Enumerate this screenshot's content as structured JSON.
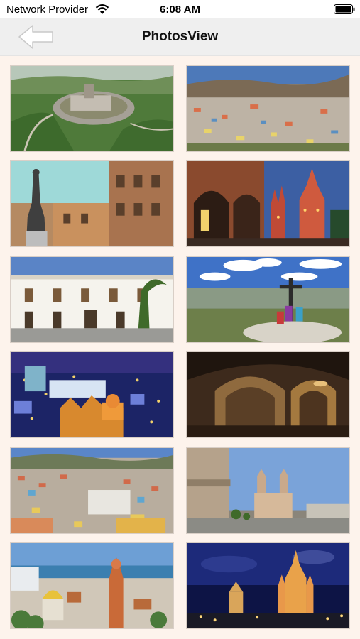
{
  "status_bar": {
    "carrier": "Network Provider",
    "time": "6:08 AM",
    "wifi_icon": "wifi-icon",
    "battery_icon": "battery-icon"
  },
  "nav": {
    "title": "PhotosView",
    "back_icon": "back-arrow-icon"
  },
  "photos": [
    {
      "scene": "aerial-monument-hill",
      "col": 0,
      "row": 0
    },
    {
      "scene": "city-valley-colorful",
      "col": 1,
      "row": 0
    },
    {
      "scene": "statue-colonial-street",
      "col": 0,
      "row": 1
    },
    {
      "scene": "arcade-cathedral-dusk",
      "col": 1,
      "row": 1
    },
    {
      "scene": "white-colonial-building",
      "col": 0,
      "row": 2
    },
    {
      "scene": "hilltop-statue-landscape",
      "col": 1,
      "row": 2
    },
    {
      "scene": "city-night-lights",
      "col": 0,
      "row": 3
    },
    {
      "scene": "underground-tunnel",
      "col": 1,
      "row": 3
    },
    {
      "scene": "colorful-hillside-city",
      "col": 0,
      "row": 4
    },
    {
      "scene": "church-plaza",
      "col": 1,
      "row": 4
    },
    {
      "scene": "coastal-church-town",
      "col": 0,
      "row": 5
    },
    {
      "scene": "cathedral-night",
      "col": 1,
      "row": 5
    }
  ]
}
